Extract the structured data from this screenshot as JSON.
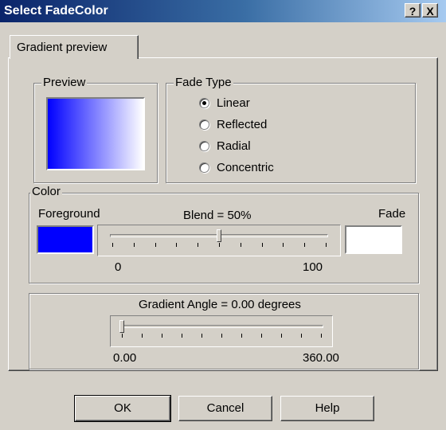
{
  "window": {
    "title": "Select FadeColor",
    "help_glyph": "?",
    "close_glyph": "X"
  },
  "tabs": [
    {
      "label": "Gradient preview",
      "active": true
    }
  ],
  "preview": {
    "label": "Preview",
    "gradient_from": "#0000ff",
    "gradient_to": "#ffffff"
  },
  "fade_type": {
    "label": "Fade Type",
    "options": [
      {
        "label": "Linear",
        "selected": true
      },
      {
        "label": "Reflected",
        "selected": false
      },
      {
        "label": "Radial",
        "selected": false
      },
      {
        "label": "Concentric",
        "selected": false
      }
    ]
  },
  "color": {
    "label": "Color",
    "foreground_label": "Foreground",
    "foreground_color": "#0000ff",
    "fade_label": "Fade",
    "fade_color": "#ffffff",
    "blend_label": "Blend =  50%",
    "blend_value": 50,
    "blend_min": "0",
    "blend_max": "100"
  },
  "angle": {
    "label": "Gradient Angle =  0.00 degrees",
    "value": 0,
    "min": "0.00",
    "max": "360.00"
  },
  "buttons": {
    "ok": "OK",
    "cancel": "Cancel",
    "help": "Help"
  }
}
